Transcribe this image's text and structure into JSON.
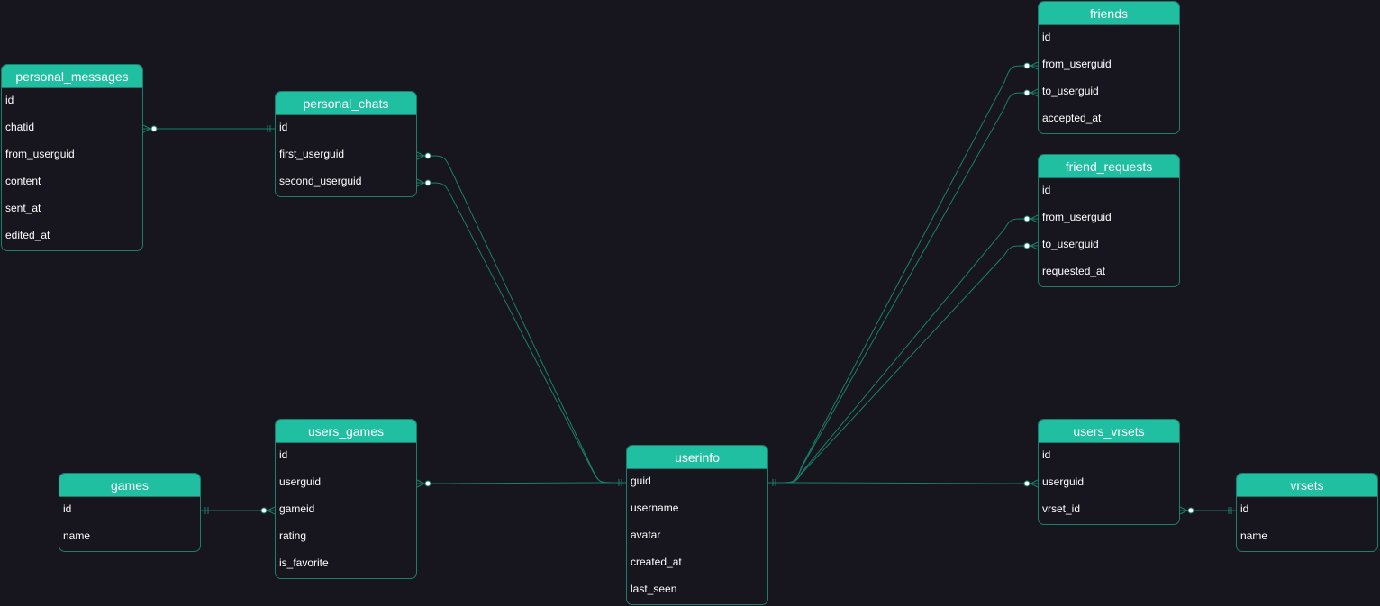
{
  "colors": {
    "background": "#17151d",
    "header": "#21bfa2",
    "border": "#1a7f6d",
    "edge": "#19806d",
    "dot": "#ffffff"
  },
  "tables": {
    "personal_messages": {
      "name": "personal_messages",
      "columns": [
        "id",
        "chatid",
        "from_userguid",
        "content",
        "sent_at",
        "edited_at"
      ]
    },
    "personal_chats": {
      "name": "personal_chats",
      "columns": [
        "id",
        "first_userguid",
        "second_userguid"
      ]
    },
    "friends": {
      "name": "friends",
      "columns": [
        "id",
        "from_userguid",
        "to_userguid",
        "accepted_at"
      ]
    },
    "friend_requests": {
      "name": "friend_requests",
      "columns": [
        "id",
        "from_userguid",
        "to_userguid",
        "requested_at"
      ]
    },
    "games": {
      "name": "games",
      "columns": [
        "id",
        "name"
      ]
    },
    "users_games": {
      "name": "users_games",
      "columns": [
        "id",
        "userguid",
        "gameid",
        "rating",
        "is_favorite"
      ]
    },
    "userinfo": {
      "name": "userinfo",
      "columns": [
        "guid",
        "username",
        "avatar",
        "created_at",
        "last_seen"
      ]
    },
    "users_vrsets": {
      "name": "users_vrsets",
      "columns": [
        "id",
        "userguid",
        "vrset_id"
      ]
    },
    "vrsets": {
      "name": "vrsets",
      "columns": [
        "id",
        "name"
      ]
    }
  },
  "relations": [
    {
      "from": "personal_messages.chatid",
      "to": "personal_chats.id"
    },
    {
      "from": "personal_chats.first_userguid",
      "to": "userinfo.guid"
    },
    {
      "from": "personal_chats.second_userguid",
      "to": "userinfo.guid"
    },
    {
      "from": "friends.from_userguid",
      "to": "userinfo.guid"
    },
    {
      "from": "friends.to_userguid",
      "to": "userinfo.guid"
    },
    {
      "from": "friend_requests.from_userguid",
      "to": "userinfo.guid"
    },
    {
      "from": "friend_requests.to_userguid",
      "to": "userinfo.guid"
    },
    {
      "from": "users_games.userguid",
      "to": "userinfo.guid"
    },
    {
      "from": "users_games.gameid",
      "to": "games.id"
    },
    {
      "from": "users_vrsets.userguid",
      "to": "userinfo.guid"
    },
    {
      "from": "users_vrsets.vrset_id",
      "to": "vrsets.id"
    }
  ]
}
